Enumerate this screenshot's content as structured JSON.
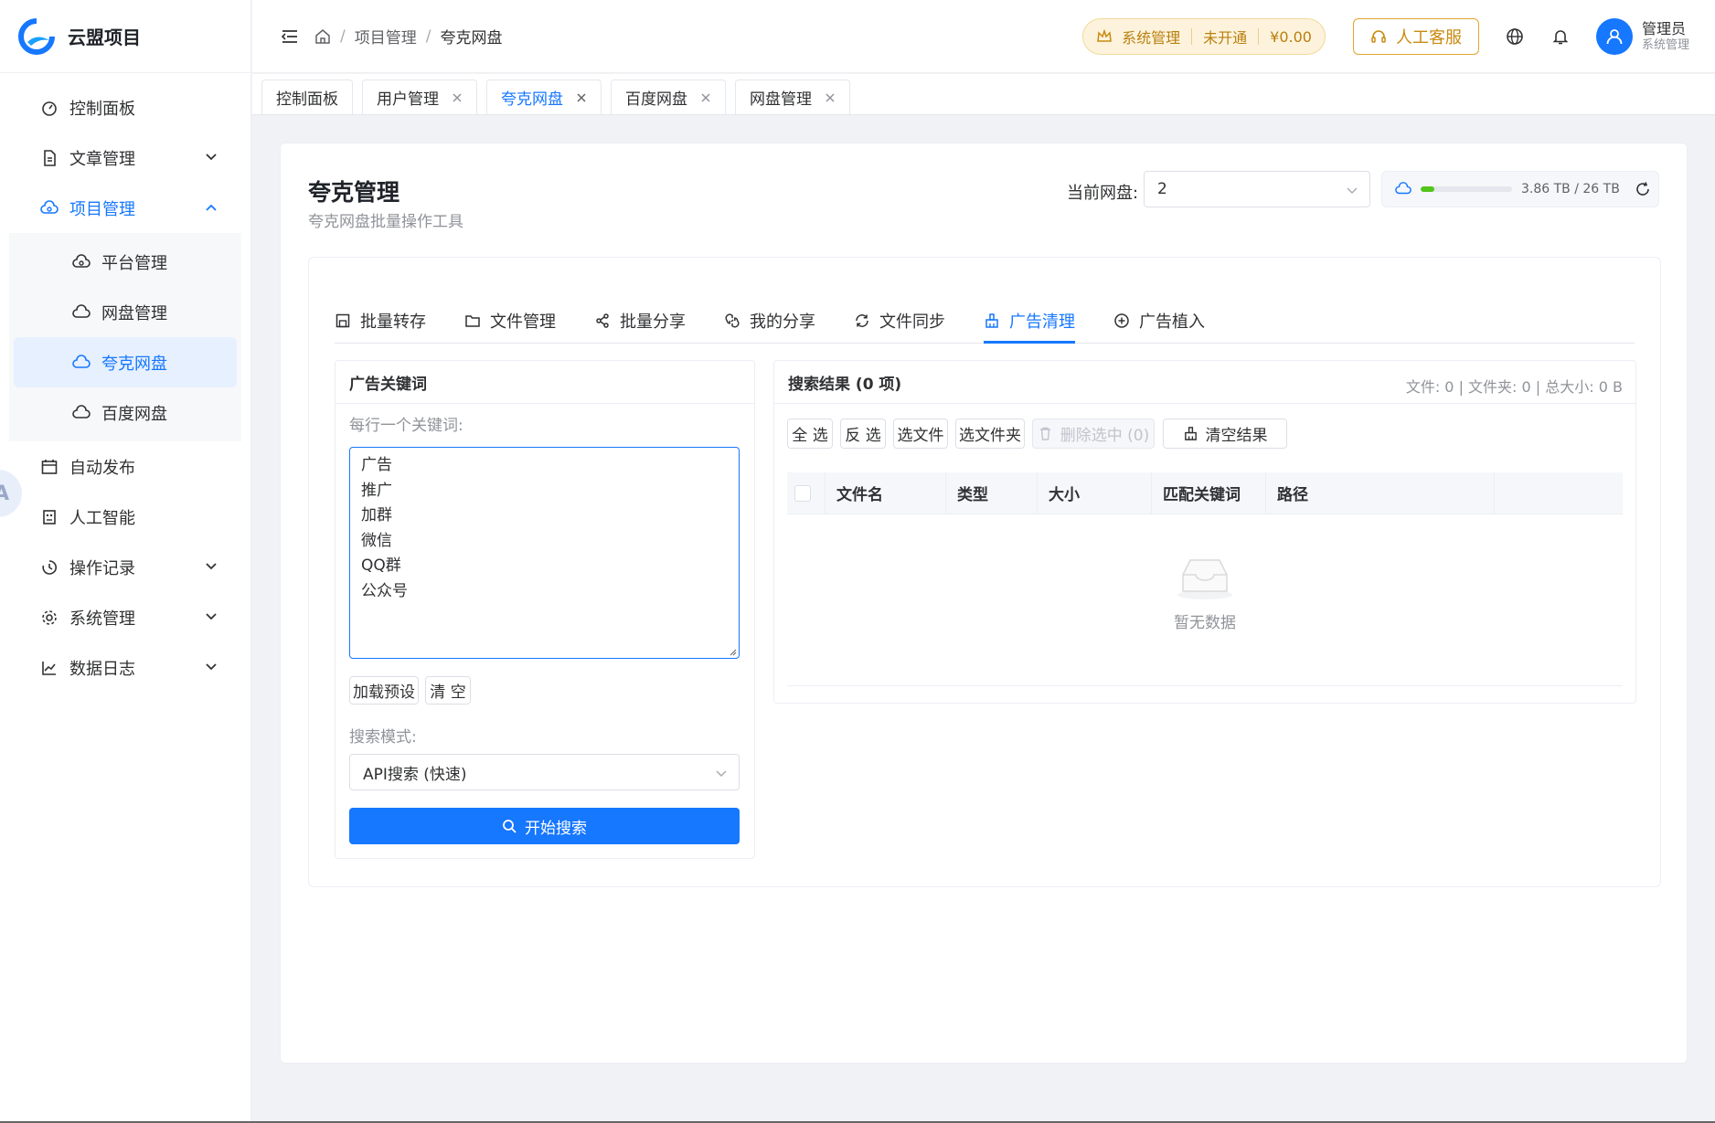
{
  "app": {
    "name": "云盟项目"
  },
  "sidebar": {
    "items": [
      {
        "label": "控制面板",
        "icon": "dashboard-icon"
      },
      {
        "label": "文章管理",
        "icon": "document-icon",
        "expandable": true
      },
      {
        "label": "项目管理",
        "icon": "cloud-gear-icon",
        "expandable": true,
        "open": true
      },
      {
        "label": "自动发布",
        "icon": "calendar-icon"
      },
      {
        "label": "人工智能",
        "icon": "robot-icon"
      },
      {
        "label": "操作记录",
        "icon": "history-icon",
        "expandable": true
      },
      {
        "label": "系统管理",
        "icon": "gear-icon",
        "expandable": true
      },
      {
        "label": "数据日志",
        "icon": "chart-icon",
        "expandable": true
      }
    ],
    "subitems": [
      {
        "label": "平台管理",
        "icon": "cloud-gear-icon"
      },
      {
        "label": "网盘管理",
        "icon": "cloud-icon"
      },
      {
        "label": "夸克网盘",
        "icon": "cloud-icon",
        "active": true
      },
      {
        "label": "百度网盘",
        "icon": "cloud-icon"
      }
    ],
    "float_badge": "A"
  },
  "header": {
    "breadcrumb": [
      "项目管理",
      "夸克网盘"
    ],
    "sys_pill": {
      "label": "系统管理",
      "status": "未开通",
      "balance": "¥0.00"
    },
    "service_button": "人工客服",
    "user": {
      "name": "管理员",
      "role": "系统管理"
    }
  },
  "tabs": [
    {
      "label": "控制面板",
      "closable": false
    },
    {
      "label": "用户管理",
      "closable": true
    },
    {
      "label": "夸克网盘",
      "closable": true,
      "active": true
    },
    {
      "label": "百度网盘",
      "closable": true
    },
    {
      "label": "网盘管理",
      "closable": true
    }
  ],
  "page": {
    "title": "夸克管理",
    "subtitle": "夸克网盘批量操作工具",
    "disk_label": "当前网盘:",
    "disk_value": "2",
    "quota_text": "3.86 TB / 26 TB",
    "quota_fraction": 0.148
  },
  "func_tabs": [
    {
      "label": "批量转存",
      "icon": "save-icon"
    },
    {
      "label": "文件管理",
      "icon": "folder-icon"
    },
    {
      "label": "批量分享",
      "icon": "share-icon"
    },
    {
      "label": "我的分享",
      "icon": "link-icon"
    },
    {
      "label": "文件同步",
      "icon": "sync-icon"
    },
    {
      "label": "广告清理",
      "icon": "broom-icon",
      "active": true
    },
    {
      "label": "广告植入",
      "icon": "plus-circle-icon"
    }
  ],
  "left_panel": {
    "title": "广告关键词",
    "keywords_label": "每行一个关键词:",
    "keywords": [
      "广告",
      "推广",
      "加群",
      "微信",
      "QQ群",
      "公众号"
    ],
    "load_preset": "加载预设",
    "clear": "清 空",
    "mode_label": "搜索模式:",
    "mode_value": "API搜索 (快速)",
    "search_button": "开始搜索"
  },
  "right_panel": {
    "title": "搜索结果 (0 项)",
    "stats": "文件: 0 | 文件夹: 0 | 总大小: 0 B",
    "actions": {
      "select_all": "全 选",
      "invert": "反 选",
      "select_files": "选文件",
      "select_folders": "选文件夹",
      "delete_selected": "删除选中 (0)",
      "clear_results": "清空结果"
    },
    "columns": [
      "文件名",
      "类型",
      "大小",
      "匹配关键词",
      "路径"
    ],
    "empty_text": "暂无数据"
  },
  "colors": {
    "primary": "#1677ff",
    "warning": "#e0a532",
    "success": "#52c41a"
  }
}
